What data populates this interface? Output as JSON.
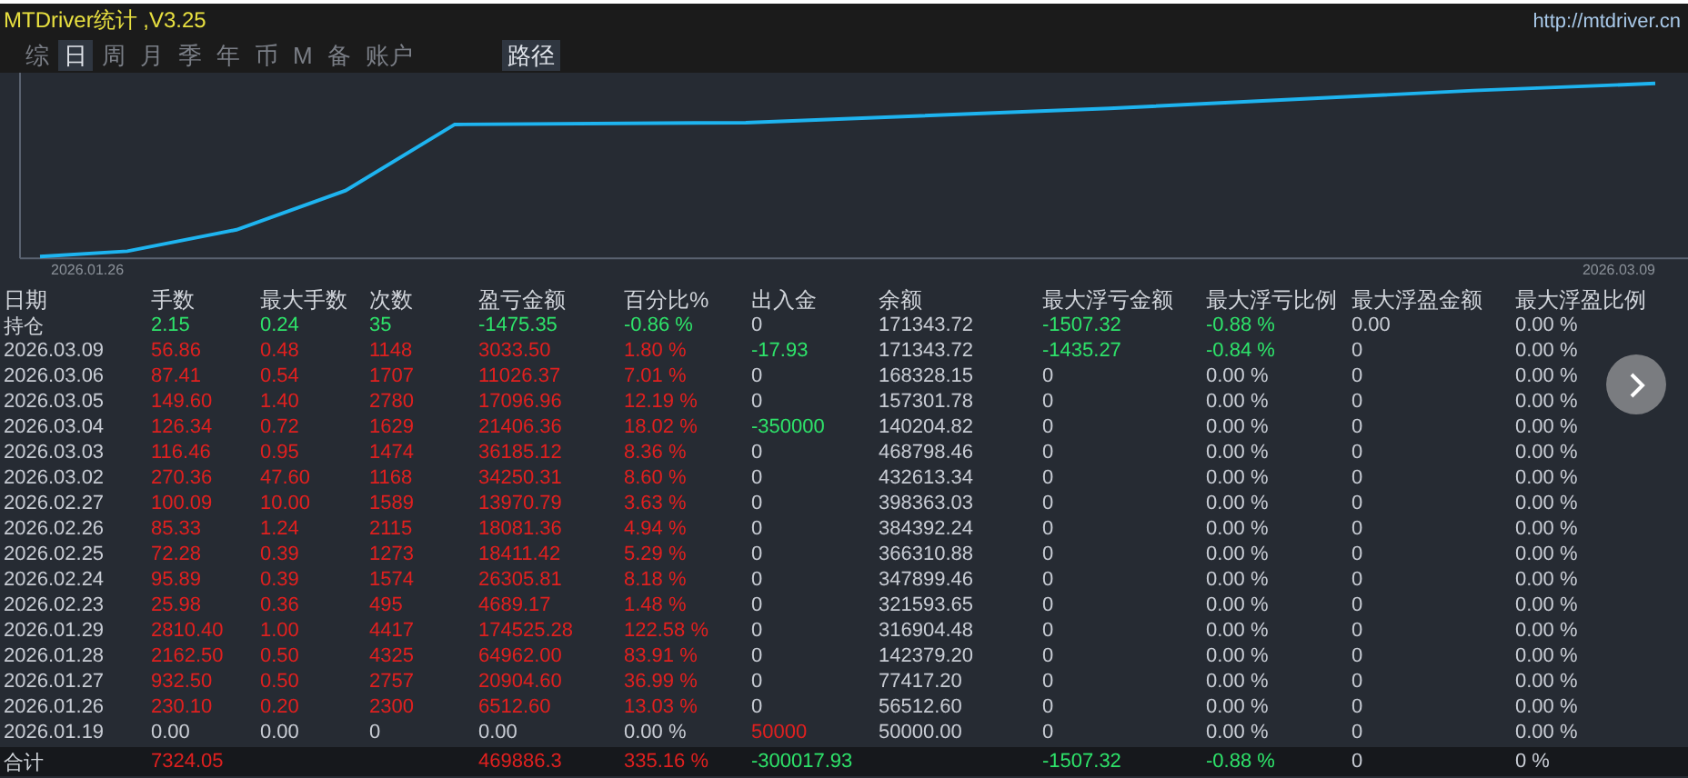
{
  "window": {
    "title": "MTDriver统计 ,V3.25",
    "url": "http://mtdriver.cn"
  },
  "tabs": [
    {
      "label": "综",
      "selected": false
    },
    {
      "label": "日",
      "selected": true
    },
    {
      "label": "周",
      "selected": false
    },
    {
      "label": "月",
      "selected": false
    },
    {
      "label": "季",
      "selected": false
    },
    {
      "label": "年",
      "selected": false
    },
    {
      "label": "币",
      "selected": false
    },
    {
      "label": "M",
      "selected": false
    },
    {
      "label": "备",
      "selected": false
    },
    {
      "label": "账户",
      "selected": false
    }
  ],
  "path_button": "路径",
  "chart": {
    "start_label": "2026.01.26",
    "end_label": "2026.03.09"
  },
  "table": {
    "columns": [
      "日期",
      "手数",
      "最大手数",
      "次数",
      "盈亏金额",
      "百分比%",
      "出入金",
      "余额",
      "最大浮亏金额",
      "最大浮亏比例",
      "最大浮盈金额",
      "最大浮盈比例"
    ],
    "rows": [
      {
        "kind": "position",
        "cells": [
          {
            "text": "持仓",
            "color": "#d0d4da"
          },
          {
            "text": "2.15",
            "color": "#2ee36a"
          },
          {
            "text": "0.24",
            "color": "#2ee36a"
          },
          {
            "text": "35",
            "color": "#2ee36a"
          },
          {
            "text": "-1475.35",
            "color": "#2ee36a"
          },
          {
            "text": "-0.86 %",
            "color": "#2ee36a"
          },
          {
            "text": "0",
            "color": "#c8ccd4"
          },
          {
            "text": "171343.72",
            "color": "#c8ccd4"
          },
          {
            "text": "-1507.32",
            "color": "#2ee36a"
          },
          {
            "text": "-0.88 %",
            "color": "#2ee36a"
          },
          {
            "text": "0.00",
            "color": "#c8ccd4"
          },
          {
            "text": "0.00 %",
            "color": "#c8ccd4"
          }
        ]
      },
      {
        "kind": "day",
        "cells": [
          {
            "text": "2026.03.09",
            "color": "#c8ccd4"
          },
          {
            "text": "56.86",
            "color": "#e0201f"
          },
          {
            "text": "0.48",
            "color": "#e0201f"
          },
          {
            "text": "1148",
            "color": "#e0201f"
          },
          {
            "text": "3033.50",
            "color": "#e0201f"
          },
          {
            "text": "1.80 %",
            "color": "#e0201f"
          },
          {
            "text": "-17.93",
            "color": "#2ee36a"
          },
          {
            "text": "171343.72",
            "color": "#c8ccd4"
          },
          {
            "text": "-1435.27",
            "color": "#2ee36a"
          },
          {
            "text": "-0.84 %",
            "color": "#2ee36a"
          },
          {
            "text": "0",
            "color": "#c8ccd4"
          },
          {
            "text": "0.00 %",
            "color": "#c8ccd4"
          }
        ]
      },
      {
        "kind": "day",
        "cells": [
          {
            "text": "2026.03.06",
            "color": "#c8ccd4"
          },
          {
            "text": "87.41",
            "color": "#e0201f"
          },
          {
            "text": "0.54",
            "color": "#e0201f"
          },
          {
            "text": "1707",
            "color": "#e0201f"
          },
          {
            "text": "11026.37",
            "color": "#e0201f"
          },
          {
            "text": "7.01 %",
            "color": "#e0201f"
          },
          {
            "text": "0",
            "color": "#c8ccd4"
          },
          {
            "text": "168328.15",
            "color": "#c8ccd4"
          },
          {
            "text": "0",
            "color": "#c8ccd4"
          },
          {
            "text": "0.00 %",
            "color": "#c8ccd4"
          },
          {
            "text": "0",
            "color": "#c8ccd4"
          },
          {
            "text": "0.00 %",
            "color": "#c8ccd4"
          }
        ]
      },
      {
        "kind": "day",
        "cells": [
          {
            "text": "2026.03.05",
            "color": "#c8ccd4"
          },
          {
            "text": "149.60",
            "color": "#e0201f"
          },
          {
            "text": "1.40",
            "color": "#e0201f"
          },
          {
            "text": "2780",
            "color": "#e0201f"
          },
          {
            "text": "17096.96",
            "color": "#e0201f"
          },
          {
            "text": "12.19 %",
            "color": "#e0201f"
          },
          {
            "text": "0",
            "color": "#c8ccd4"
          },
          {
            "text": "157301.78",
            "color": "#c8ccd4"
          },
          {
            "text": "0",
            "color": "#c8ccd4"
          },
          {
            "text": "0.00 %",
            "color": "#c8ccd4"
          },
          {
            "text": "0",
            "color": "#c8ccd4"
          },
          {
            "text": "0.00 %",
            "color": "#c8ccd4"
          }
        ]
      },
      {
        "kind": "day",
        "cells": [
          {
            "text": "2026.03.04",
            "color": "#c8ccd4"
          },
          {
            "text": "126.34",
            "color": "#e0201f"
          },
          {
            "text": "0.72",
            "color": "#e0201f"
          },
          {
            "text": "1629",
            "color": "#e0201f"
          },
          {
            "text": "21406.36",
            "color": "#e0201f"
          },
          {
            "text": "18.02 %",
            "color": "#e0201f"
          },
          {
            "text": "-350000",
            "color": "#2ee36a"
          },
          {
            "text": "140204.82",
            "color": "#c8ccd4"
          },
          {
            "text": "0",
            "color": "#c8ccd4"
          },
          {
            "text": "0.00 %",
            "color": "#c8ccd4"
          },
          {
            "text": "0",
            "color": "#c8ccd4"
          },
          {
            "text": "0.00 %",
            "color": "#c8ccd4"
          }
        ]
      },
      {
        "kind": "day",
        "cells": [
          {
            "text": "2026.03.03",
            "color": "#c8ccd4"
          },
          {
            "text": "116.46",
            "color": "#e0201f"
          },
          {
            "text": "0.95",
            "color": "#e0201f"
          },
          {
            "text": "1474",
            "color": "#e0201f"
          },
          {
            "text": "36185.12",
            "color": "#e0201f"
          },
          {
            "text": "8.36 %",
            "color": "#e0201f"
          },
          {
            "text": "0",
            "color": "#c8ccd4"
          },
          {
            "text": "468798.46",
            "color": "#c8ccd4"
          },
          {
            "text": "0",
            "color": "#c8ccd4"
          },
          {
            "text": "0.00 %",
            "color": "#c8ccd4"
          },
          {
            "text": "0",
            "color": "#c8ccd4"
          },
          {
            "text": "0.00 %",
            "color": "#c8ccd4"
          }
        ]
      },
      {
        "kind": "day",
        "cells": [
          {
            "text": "2026.03.02",
            "color": "#c8ccd4"
          },
          {
            "text": "270.36",
            "color": "#e0201f"
          },
          {
            "text": "47.60",
            "color": "#e0201f"
          },
          {
            "text": "1168",
            "color": "#e0201f"
          },
          {
            "text": "34250.31",
            "color": "#e0201f"
          },
          {
            "text": "8.60 %",
            "color": "#e0201f"
          },
          {
            "text": "0",
            "color": "#c8ccd4"
          },
          {
            "text": "432613.34",
            "color": "#c8ccd4"
          },
          {
            "text": "0",
            "color": "#c8ccd4"
          },
          {
            "text": "0.00 %",
            "color": "#c8ccd4"
          },
          {
            "text": "0",
            "color": "#c8ccd4"
          },
          {
            "text": "0.00 %",
            "color": "#c8ccd4"
          }
        ]
      },
      {
        "kind": "day",
        "cells": [
          {
            "text": "2026.02.27",
            "color": "#c8ccd4"
          },
          {
            "text": "100.09",
            "color": "#e0201f"
          },
          {
            "text": "10.00",
            "color": "#e0201f"
          },
          {
            "text": "1589",
            "color": "#e0201f"
          },
          {
            "text": "13970.79",
            "color": "#e0201f"
          },
          {
            "text": "3.63 %",
            "color": "#e0201f"
          },
          {
            "text": "0",
            "color": "#c8ccd4"
          },
          {
            "text": "398363.03",
            "color": "#c8ccd4"
          },
          {
            "text": "0",
            "color": "#c8ccd4"
          },
          {
            "text": "0.00 %",
            "color": "#c8ccd4"
          },
          {
            "text": "0",
            "color": "#c8ccd4"
          },
          {
            "text": "0.00 %",
            "color": "#c8ccd4"
          }
        ]
      },
      {
        "kind": "day",
        "cells": [
          {
            "text": "2026.02.26",
            "color": "#c8ccd4"
          },
          {
            "text": "85.33",
            "color": "#e0201f"
          },
          {
            "text": "1.24",
            "color": "#e0201f"
          },
          {
            "text": "2115",
            "color": "#e0201f"
          },
          {
            "text": "18081.36",
            "color": "#e0201f"
          },
          {
            "text": "4.94 %",
            "color": "#e0201f"
          },
          {
            "text": "0",
            "color": "#c8ccd4"
          },
          {
            "text": "384392.24",
            "color": "#c8ccd4"
          },
          {
            "text": "0",
            "color": "#c8ccd4"
          },
          {
            "text": "0.00 %",
            "color": "#c8ccd4"
          },
          {
            "text": "0",
            "color": "#c8ccd4"
          },
          {
            "text": "0.00 %",
            "color": "#c8ccd4"
          }
        ]
      },
      {
        "kind": "day",
        "cells": [
          {
            "text": "2026.02.25",
            "color": "#c8ccd4"
          },
          {
            "text": "72.28",
            "color": "#e0201f"
          },
          {
            "text": "0.39",
            "color": "#e0201f"
          },
          {
            "text": "1273",
            "color": "#e0201f"
          },
          {
            "text": "18411.42",
            "color": "#e0201f"
          },
          {
            "text": "5.29 %",
            "color": "#e0201f"
          },
          {
            "text": "0",
            "color": "#c8ccd4"
          },
          {
            "text": "366310.88",
            "color": "#c8ccd4"
          },
          {
            "text": "0",
            "color": "#c8ccd4"
          },
          {
            "text": "0.00 %",
            "color": "#c8ccd4"
          },
          {
            "text": "0",
            "color": "#c8ccd4"
          },
          {
            "text": "0.00 %",
            "color": "#c8ccd4"
          }
        ]
      },
      {
        "kind": "day",
        "cells": [
          {
            "text": "2026.02.24",
            "color": "#c8ccd4"
          },
          {
            "text": "95.89",
            "color": "#e0201f"
          },
          {
            "text": "0.39",
            "color": "#e0201f"
          },
          {
            "text": "1574",
            "color": "#e0201f"
          },
          {
            "text": "26305.81",
            "color": "#e0201f"
          },
          {
            "text": "8.18 %",
            "color": "#e0201f"
          },
          {
            "text": "0",
            "color": "#c8ccd4"
          },
          {
            "text": "347899.46",
            "color": "#c8ccd4"
          },
          {
            "text": "0",
            "color": "#c8ccd4"
          },
          {
            "text": "0.00 %",
            "color": "#c8ccd4"
          },
          {
            "text": "0",
            "color": "#c8ccd4"
          },
          {
            "text": "0.00 %",
            "color": "#c8ccd4"
          }
        ]
      },
      {
        "kind": "day",
        "cells": [
          {
            "text": "2026.02.23",
            "color": "#c8ccd4"
          },
          {
            "text": "25.98",
            "color": "#e0201f"
          },
          {
            "text": "0.36",
            "color": "#e0201f"
          },
          {
            "text": "495",
            "color": "#e0201f"
          },
          {
            "text": "4689.17",
            "color": "#e0201f"
          },
          {
            "text": "1.48 %",
            "color": "#e0201f"
          },
          {
            "text": "0",
            "color": "#c8ccd4"
          },
          {
            "text": "321593.65",
            "color": "#c8ccd4"
          },
          {
            "text": "0",
            "color": "#c8ccd4"
          },
          {
            "text": "0.00 %",
            "color": "#c8ccd4"
          },
          {
            "text": "0",
            "color": "#c8ccd4"
          },
          {
            "text": "0.00 %",
            "color": "#c8ccd4"
          }
        ]
      },
      {
        "kind": "day",
        "cells": [
          {
            "text": "2026.01.29",
            "color": "#c8ccd4"
          },
          {
            "text": "2810.40",
            "color": "#e0201f"
          },
          {
            "text": "1.00",
            "color": "#e0201f"
          },
          {
            "text": "4417",
            "color": "#e0201f"
          },
          {
            "text": "174525.28",
            "color": "#e0201f"
          },
          {
            "text": "122.58 %",
            "color": "#e0201f"
          },
          {
            "text": "0",
            "color": "#c8ccd4"
          },
          {
            "text": "316904.48",
            "color": "#c8ccd4"
          },
          {
            "text": "0",
            "color": "#c8ccd4"
          },
          {
            "text": "0.00 %",
            "color": "#c8ccd4"
          },
          {
            "text": "0",
            "color": "#c8ccd4"
          },
          {
            "text": "0.00 %",
            "color": "#c8ccd4"
          }
        ]
      },
      {
        "kind": "day",
        "cells": [
          {
            "text": "2026.01.28",
            "color": "#c8ccd4"
          },
          {
            "text": "2162.50",
            "color": "#e0201f"
          },
          {
            "text": "0.50",
            "color": "#e0201f"
          },
          {
            "text": "4325",
            "color": "#e0201f"
          },
          {
            "text": "64962.00",
            "color": "#e0201f"
          },
          {
            "text": "83.91 %",
            "color": "#e0201f"
          },
          {
            "text": "0",
            "color": "#c8ccd4"
          },
          {
            "text": "142379.20",
            "color": "#c8ccd4"
          },
          {
            "text": "0",
            "color": "#c8ccd4"
          },
          {
            "text": "0.00 %",
            "color": "#c8ccd4"
          },
          {
            "text": "0",
            "color": "#c8ccd4"
          },
          {
            "text": "0.00 %",
            "color": "#c8ccd4"
          }
        ]
      },
      {
        "kind": "day",
        "cells": [
          {
            "text": "2026.01.27",
            "color": "#c8ccd4"
          },
          {
            "text": "932.50",
            "color": "#e0201f"
          },
          {
            "text": "0.50",
            "color": "#e0201f"
          },
          {
            "text": "2757",
            "color": "#e0201f"
          },
          {
            "text": "20904.60",
            "color": "#e0201f"
          },
          {
            "text": "36.99 %",
            "color": "#e0201f"
          },
          {
            "text": "0",
            "color": "#c8ccd4"
          },
          {
            "text": "77417.20",
            "color": "#c8ccd4"
          },
          {
            "text": "0",
            "color": "#c8ccd4"
          },
          {
            "text": "0.00 %",
            "color": "#c8ccd4"
          },
          {
            "text": "0",
            "color": "#c8ccd4"
          },
          {
            "text": "0.00 %",
            "color": "#c8ccd4"
          }
        ]
      },
      {
        "kind": "day",
        "cells": [
          {
            "text": "2026.01.26",
            "color": "#c8ccd4"
          },
          {
            "text": "230.10",
            "color": "#e0201f"
          },
          {
            "text": "0.20",
            "color": "#e0201f"
          },
          {
            "text": "2300",
            "color": "#e0201f"
          },
          {
            "text": "6512.60",
            "color": "#e0201f"
          },
          {
            "text": "13.03 %",
            "color": "#e0201f"
          },
          {
            "text": "0",
            "color": "#c8ccd4"
          },
          {
            "text": "56512.60",
            "color": "#c8ccd4"
          },
          {
            "text": "0",
            "color": "#c8ccd4"
          },
          {
            "text": "0.00 %",
            "color": "#c8ccd4"
          },
          {
            "text": "0",
            "color": "#c8ccd4"
          },
          {
            "text": "0.00 %",
            "color": "#c8ccd4"
          }
        ]
      },
      {
        "kind": "day",
        "cells": [
          {
            "text": "2026.01.19",
            "color": "#c8ccd4"
          },
          {
            "text": "0.00",
            "color": "#c8ccd4"
          },
          {
            "text": "0.00",
            "color": "#c8ccd4"
          },
          {
            "text": "0",
            "color": "#c8ccd4"
          },
          {
            "text": "0.00",
            "color": "#c8ccd4"
          },
          {
            "text": "0.00 %",
            "color": "#c8ccd4"
          },
          {
            "text": "50000",
            "color": "#e0201f"
          },
          {
            "text": "50000.00",
            "color": "#c8ccd4"
          },
          {
            "text": "0",
            "color": "#c8ccd4"
          },
          {
            "text": "0.00 %",
            "color": "#c8ccd4"
          },
          {
            "text": "0",
            "color": "#c8ccd4"
          },
          {
            "text": "0.00 %",
            "color": "#c8ccd4"
          }
        ]
      },
      {
        "kind": "total",
        "cells": [
          {
            "text": "合计",
            "color": "#d0d4da"
          },
          {
            "text": "7324.05",
            "color": "#e0201f"
          },
          null,
          null,
          {
            "text": "469886.3",
            "color": "#e0201f"
          },
          {
            "text": "335.16 %",
            "color": "#e0201f"
          },
          {
            "text": "-300017.93",
            "color": "#2ee36a"
          },
          null,
          {
            "text": "-1507.32",
            "color": "#2ee36a"
          },
          {
            "text": "-0.88 %",
            "color": "#2ee36a"
          },
          {
            "text": "0",
            "color": "#c8ccd4"
          },
          {
            "text": "0 %",
            "color": "#c8ccd4"
          }
        ]
      }
    ]
  }
}
